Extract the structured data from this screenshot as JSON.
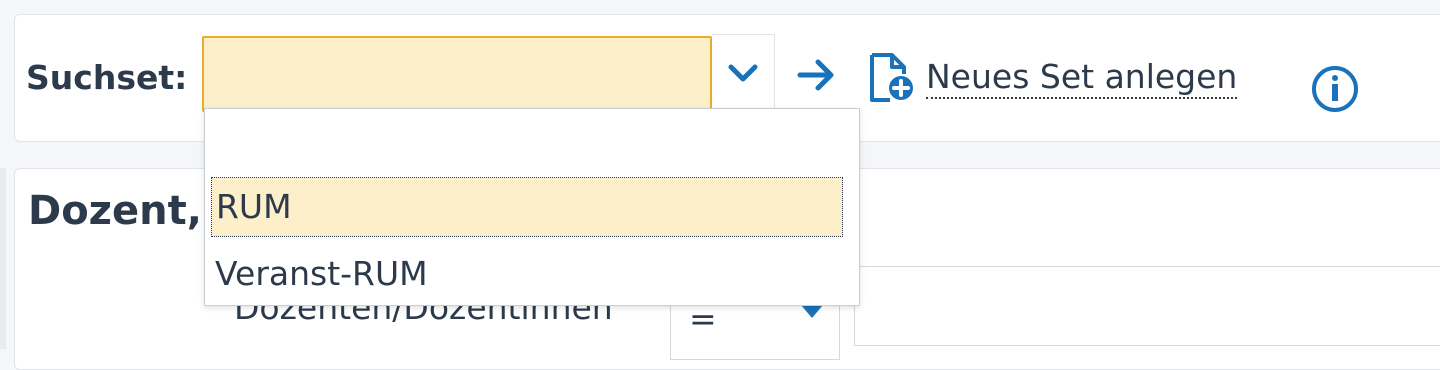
{
  "search_set": {
    "label": "Suchset:",
    "input_value": "",
    "options": [
      "",
      "RUM",
      "Veranst-RUM"
    ],
    "highlighted_option": "RUM"
  },
  "toolbar": {
    "new_set_label": "Neues Set anlegen",
    "icons": [
      "chevron-down-icon",
      "arrow-right-icon",
      "new-document-icon",
      "info-icon"
    ]
  },
  "section": {
    "title": "Dozent,",
    "field_label": "Dozenten/Dozentinnen",
    "operator_value": "="
  },
  "colors": {
    "accent_blue": "#1a72bb",
    "input_highlight": "#fdefca",
    "input_border": "#e6ad28",
    "text": "#2c3a4b"
  }
}
